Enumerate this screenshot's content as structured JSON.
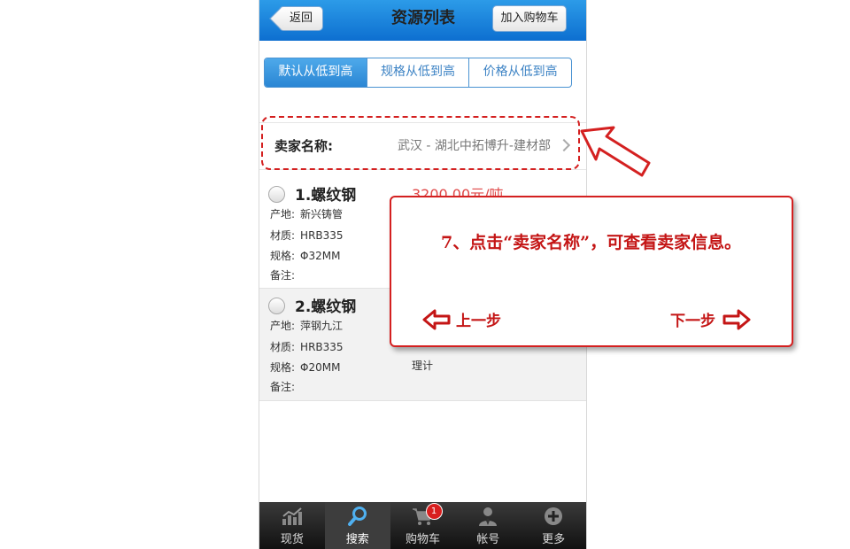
{
  "navbar": {
    "back_label": "返回",
    "title": "资源列表",
    "cart_label": "加入购物车"
  },
  "sort_tabs": [
    {
      "label": "默认从低到高",
      "active": true
    },
    {
      "label": "规格从低到高",
      "active": false
    },
    {
      "label": "价格从低到高",
      "active": false
    }
  ],
  "seller": {
    "label": "卖家名称:",
    "value": "武汉 - 湖北中拓博升-建材部"
  },
  "items": [
    {
      "name": "1.螺纹钢",
      "price": "3200.00元/吨",
      "origin_label": "产地:",
      "origin": "新兴铸管",
      "material_label": "材质:",
      "material": "HRB335",
      "spec_label": "规格:",
      "spec": "Φ32MM",
      "note_label": "备注:",
      "note": ""
    },
    {
      "name": "2.螺纹钢",
      "price": "",
      "origin_label": "产地:",
      "origin": "萍钢九江",
      "material_label": "材质:",
      "material": "HRB335",
      "spec_label": "规格:",
      "spec": "Φ20MM",
      "note_label": "备注:",
      "note": "",
      "calc": "理计"
    }
  ],
  "tabbar": [
    {
      "label": "现货",
      "icon": "chart-icon",
      "active": false
    },
    {
      "label": "搜索",
      "icon": "search-icon",
      "active": true
    },
    {
      "label": "购物车",
      "icon": "cart-icon",
      "active": false,
      "badge": "1"
    },
    {
      "label": "帐号",
      "icon": "user-icon",
      "active": false
    },
    {
      "label": "更多",
      "icon": "plus-icon",
      "active": false
    }
  ],
  "tooltip": {
    "text": "7、点击“卖家名称”，可查看卖家信息。",
    "prev_label": "上一步",
    "next_label": "下一步"
  },
  "colors": {
    "nav_blue": "#1a82dc",
    "tooltip_red": "#c41515",
    "price_red": "#e04848"
  }
}
